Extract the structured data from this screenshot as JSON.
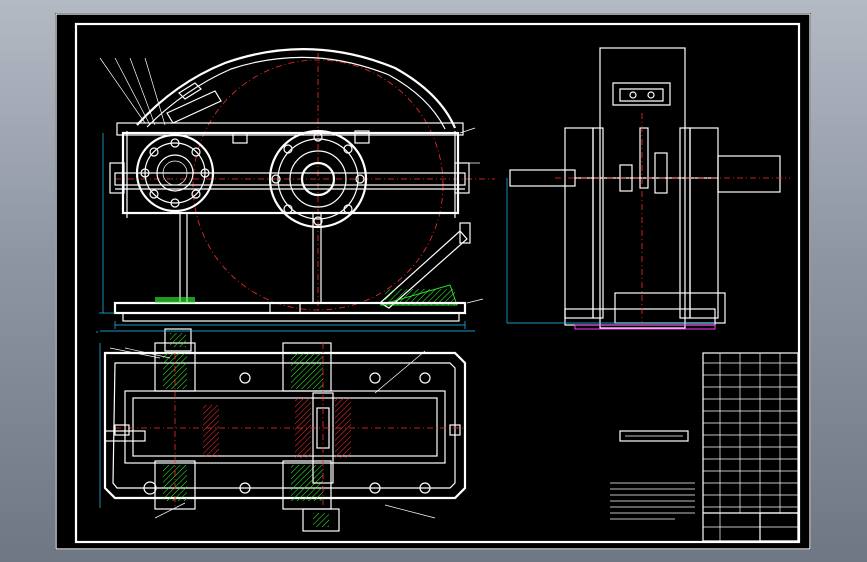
{
  "canvas": {
    "background": "#000000",
    "window_bg": "#8e96a3"
  },
  "colors": {
    "outline": "#ffffff",
    "centerline": "#ff2a2a",
    "dimension": "#20c8ff",
    "section": "#33ff33",
    "highlight": "#ff3cff"
  },
  "views": {
    "front": "front-elevation",
    "side": "side-elevation",
    "plan": "plan-section"
  },
  "notes_block": {
    "lines": 6
  },
  "title_block": {
    "rows": 16
  }
}
